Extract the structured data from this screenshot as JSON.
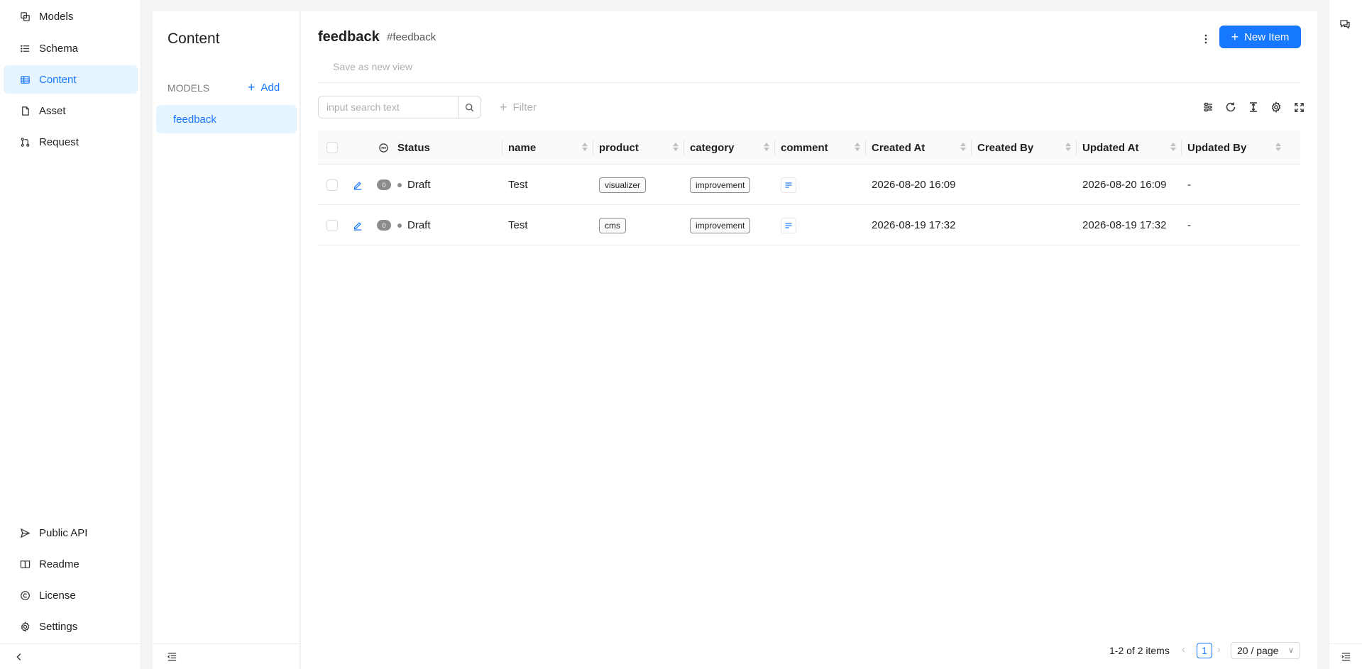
{
  "nav": {
    "items": [
      {
        "label": "Models",
        "icon": "models-icon"
      },
      {
        "label": "Schema",
        "icon": "schema-icon"
      },
      {
        "label": "Content",
        "icon": "content-table-icon",
        "active": true
      },
      {
        "label": "Asset",
        "icon": "file-icon"
      },
      {
        "label": "Request",
        "icon": "pull-request-icon"
      }
    ],
    "bottom_items": [
      {
        "label": "Public API",
        "icon": "send-icon"
      },
      {
        "label": "Readme",
        "icon": "book-icon"
      },
      {
        "label": "License",
        "icon": "copyright-icon"
      },
      {
        "label": "Settings",
        "icon": "gear-icon"
      }
    ],
    "collapse_icon": "chevron-left-icon"
  },
  "models_panel": {
    "title": "Content",
    "models_label": "MODELS",
    "add_label": "Add",
    "items": [
      "feedback"
    ]
  },
  "header": {
    "title": "feedback",
    "key": "#feedback",
    "new_item_label": "New Item",
    "save_view_label": "Save as new view"
  },
  "toolbar": {
    "search_placeholder": "input search text",
    "filter_label": "Filter"
  },
  "table": {
    "columns": [
      "Status",
      "name",
      "product",
      "category",
      "comment",
      "Created At",
      "Created By",
      "Updated At",
      "Updated By"
    ],
    "rows": [
      {
        "comments": "0",
        "status": "Draft",
        "name": "Test",
        "product": "visualizer",
        "category": "improvement",
        "created_at": "2026-08-20 16:09",
        "created_by": "",
        "updated_at": "2026-08-20 16:09",
        "updated_by": "-"
      },
      {
        "comments": "0",
        "status": "Draft",
        "name": "Test",
        "product": "cms",
        "category": "improvement",
        "created_at": "2026-08-19 17:32",
        "created_by": "",
        "updated_at": "2026-08-19 17:32",
        "updated_by": "-"
      }
    ]
  },
  "pagination": {
    "total_text": "1-2 of 2 items",
    "current_page": "1",
    "page_size": "20 / page"
  },
  "colors": {
    "accent": "#1677ff",
    "active_bg": "#e6f4ff"
  }
}
